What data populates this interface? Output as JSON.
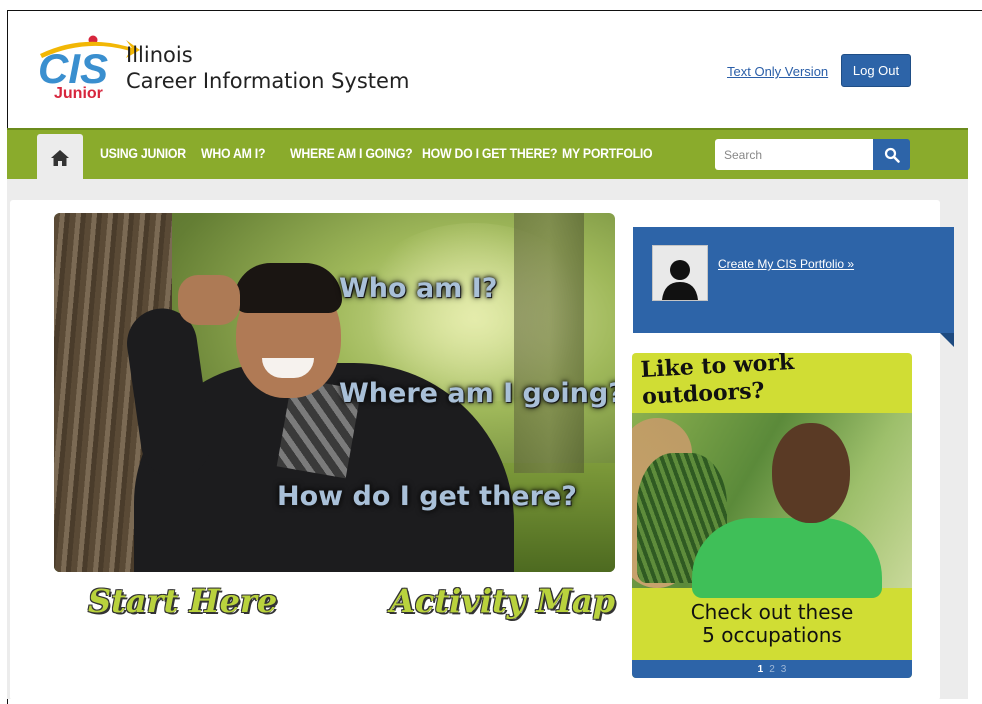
{
  "header": {
    "logo": {
      "brand": "CIS",
      "sub": "Junior"
    },
    "title_line1": "Illinois",
    "title_line2": "Career Information System",
    "text_only_link": "Text Only Version",
    "logout_label": "Log Out"
  },
  "nav": {
    "items": [
      {
        "label": "USING JUNIOR"
      },
      {
        "label": "WHO AM I?"
      },
      {
        "label": "WHERE AM I GOING?"
      },
      {
        "label": "HOW DO I GET THERE?"
      },
      {
        "label": "MY PORTFOLIO"
      }
    ],
    "search_placeholder": "Search",
    "icons": {
      "home": "home-icon",
      "search": "search-icon"
    }
  },
  "hero": {
    "questions": [
      "Who am I?",
      "Where am I going?",
      "How do I get there?"
    ],
    "start_here": "Start Here",
    "activity_map": "Activity Map"
  },
  "portfolio": {
    "link_text": "Create My CIS Portfolio »",
    "icon": "user-silhouette-icon"
  },
  "promo": {
    "title": "Like to work outdoors?",
    "caption_line1": "Check out these",
    "caption_line2": "5 occupations",
    "pages": [
      "1",
      "2",
      "3"
    ],
    "active_page": "1"
  },
  "colors": {
    "nav_green": "#8aab2c",
    "brand_blue": "#2d64a8",
    "promo_yellow": "#d0dd34",
    "script_green": "#b9d23d"
  }
}
